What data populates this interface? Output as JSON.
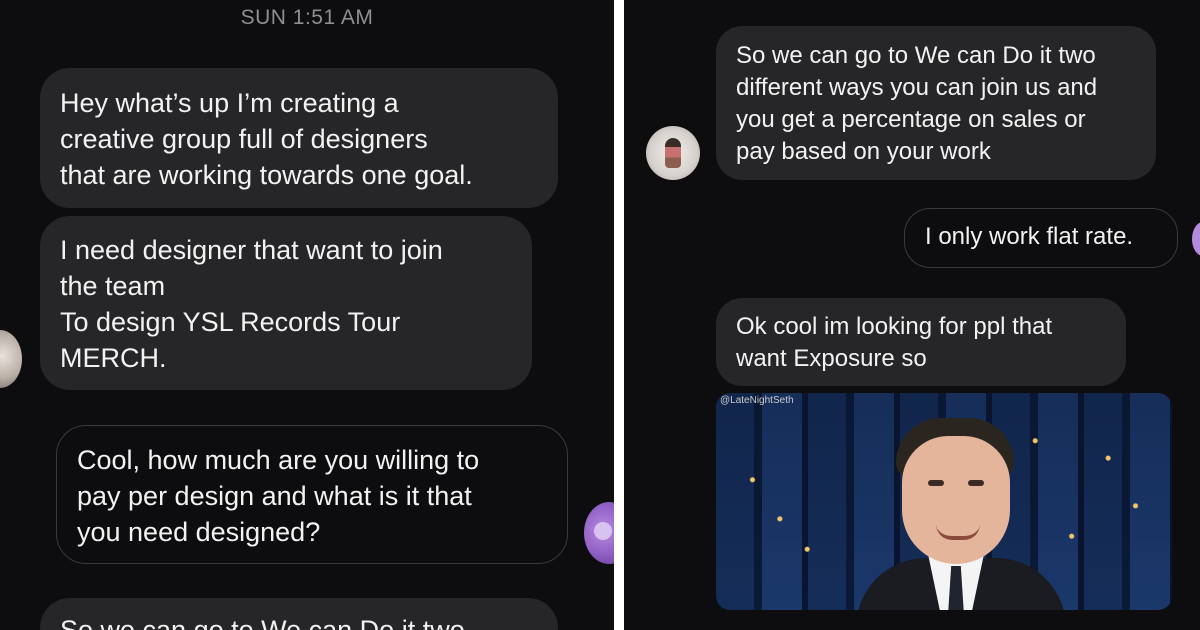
{
  "left_panel": {
    "timestamp": "SUN 1:51 AM",
    "messages": [
      {
        "direction": "incoming",
        "text": "Hey what’s up I’m creating a\ncreative group full of designers\nthat are working towards one goal."
      },
      {
        "direction": "incoming",
        "text": "I need designer that want to join\nthe team\nTo design YSL Records Tour\nMERCH."
      },
      {
        "direction": "outgoing",
        "text": "Cool, how much are you willing to\npay per design and what is it that\nyou need designed?"
      },
      {
        "direction": "incoming",
        "text": "So we can go to We can Do it two"
      }
    ]
  },
  "right_panel": {
    "messages": [
      {
        "direction": "incoming",
        "text": "So we can go to We can Do it two\ndifferent ways you can join us and\nyou get a percentage on sales or\npay based on your work"
      },
      {
        "direction": "outgoing",
        "text": "I only work flat rate."
      },
      {
        "direction": "incoming",
        "text": "Ok cool im looking for ppl that\nwant Exposure so"
      }
    ],
    "gif": {
      "watermark": "@LateNightSeth"
    }
  },
  "colors": {
    "background": "#0d0d0f",
    "incoming_bubble": "#262629",
    "outgoing_border": "#3a3a3e",
    "text": "#f2f2f2",
    "timestamp": "#8e8e93",
    "avatar_accent": "#8f5fc4"
  },
  "icons": [
    "avatar",
    "avatar",
    "avatar",
    "avatar"
  ]
}
